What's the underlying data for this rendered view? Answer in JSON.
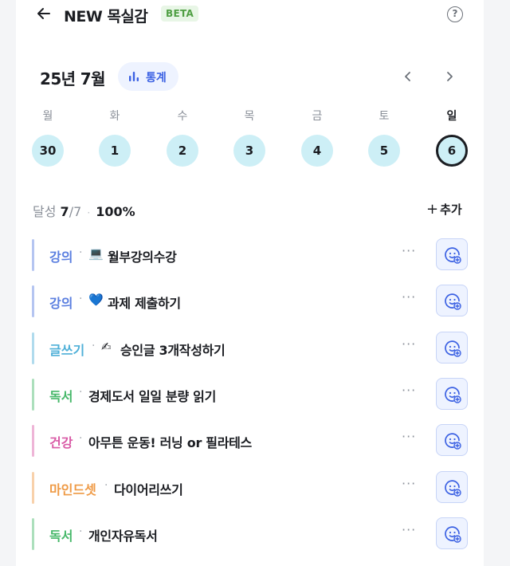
{
  "header": {
    "title": "NEW 목실감",
    "badge": "BETA",
    "help_label": "?"
  },
  "calendar": {
    "month_label": "25년 7월",
    "stats_label": "통계",
    "weekdays": [
      "월",
      "화",
      "수",
      "목",
      "금",
      "토",
      "일"
    ],
    "dates": [
      "30",
      "1",
      "2",
      "3",
      "4",
      "5",
      "6"
    ],
    "selected_index": 6
  },
  "progress": {
    "label": "달성",
    "done": "7",
    "total": "/7",
    "separator": "·",
    "percent": "100%"
  },
  "add_label": "추가",
  "tasks": [
    {
      "category": "강의",
      "emoji": "💻",
      "title": "월부강의수강",
      "color": "#5b7fe0"
    },
    {
      "category": "강의",
      "emoji": "💙",
      "title": "과제 제출하기",
      "color": "#5b7fe0"
    },
    {
      "category": "글쓰기",
      "emoji": "✍",
      "title": "승인글 3개작성하기",
      "color": "#4fb0d8"
    },
    {
      "category": "독서",
      "emoji": "",
      "title": "경제도서 일일 분량 읽기",
      "color": "#47b86a"
    },
    {
      "category": "건강",
      "emoji": "",
      "title": "아무튼 운동! 러닝 or 필라테스",
      "color": "#d95ba6"
    },
    {
      "category": "마인드셋",
      "emoji": "",
      "title": "다이어리쓰기",
      "color": "#ef9a45"
    },
    {
      "category": "독서",
      "emoji": "",
      "title": "개인자유독서",
      "color": "#47b86a"
    }
  ],
  "task_separator": "·",
  "more_label": "···",
  "colors": {
    "accent": "#3b61e3",
    "day_bg": "#cdeff6",
    "beta_bg": "#e8f6e6",
    "beta_text": "#4f9f43"
  }
}
